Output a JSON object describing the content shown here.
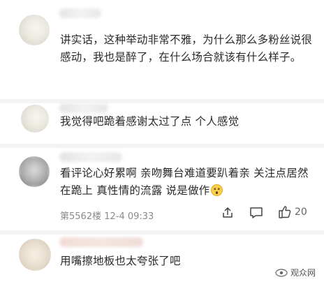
{
  "comments": [
    {
      "text": "讲实话，这种举动非常不雅，为什么那么多粉丝说很感动，我也是醉了，在什么场合就该有什么样子。"
    },
    {
      "text": "我觉得吧跪着感谢太过了点 个人感觉"
    },
    {
      "text": "看评论心好累啊 亲吻舞台难道要趴着亲 关注点居然在跪上 真性情的流露 说是做作",
      "meta": "第5562楼 12-4 09:33",
      "like_count": "20"
    },
    {
      "text": "用嘴擦地板也太夸张了吧"
    }
  ],
  "watermark": "观众网",
  "icons": {
    "share": "share-icon",
    "comment": "comment-icon",
    "like": "thumbs-up-icon",
    "emoji": "dizzy-face-emoji-icon",
    "watermark": "watermark-logo-icon"
  }
}
